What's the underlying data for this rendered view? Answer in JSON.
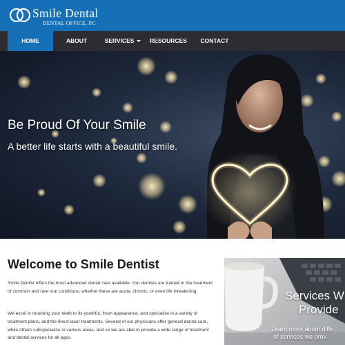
{
  "brand": {
    "name": "Smile Dental",
    "subtitle": "DENTAL OFFICE, PC",
    "accent_color": "#1570b8",
    "nav_bg_color": "#2b2d33",
    "logo_icon": "double-ring-logo-icon"
  },
  "nav": {
    "items": [
      {
        "label": "HOME",
        "active": true
      },
      {
        "label": "ABOUT",
        "active": false
      },
      {
        "label": "SERVICES",
        "active": false,
        "dropdown": true
      },
      {
        "label": "RESOURCES",
        "active": false
      },
      {
        "label": "CONTACT",
        "active": false
      }
    ]
  },
  "hero": {
    "title": "Be Proud Of Your Smile",
    "subtitle": "A better life starts with a beautiful smile.",
    "image_icon": "woman-holding-heart-lights-photo"
  },
  "welcome": {
    "title": "Welcome to Smile Dentist",
    "paragraphs": [
      "Smile Dentist offers the most advanced dental care available. Our dentists are trained in the treatment of common and rare oral conditions, whether these are acute, chronic, or even life threatening.",
      "We excel in returning your teeth to its youthful, fresh appearance, and specialize in a variety of treatment plans, and the finest laser treatments. Several of our physicians offer general dental care, while others subspecialize in various areas, and so we are able to provide a wide range of treatment and dental services for all ages."
    ]
  },
  "services_card": {
    "title_line1": "Services W",
    "title_line2": "Provide",
    "note_line1": "Learn more about diffe",
    "note_line2": "of services we prov",
    "image_icon": "coffee-mug-and-keyboard-photo"
  }
}
